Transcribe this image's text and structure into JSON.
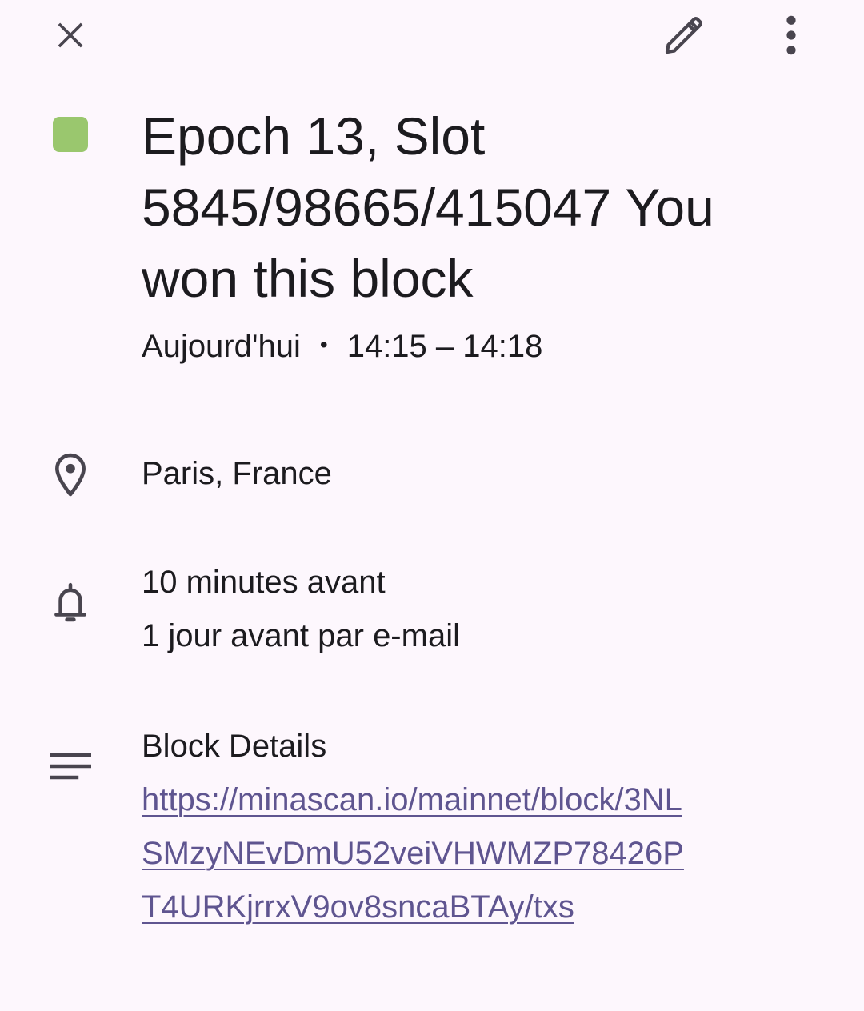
{
  "event": {
    "title": "Epoch 13, Slot 5845/98665/415047 You won this block",
    "color": "#9ac76e",
    "date": "Aujourd'hui",
    "separator": "•",
    "time_range": "14:15 – 14:18"
  },
  "location": {
    "text": "Paris, France"
  },
  "reminders": [
    {
      "text": "10 minutes avant"
    },
    {
      "text": "1 jour avant par e-mail"
    }
  ],
  "description": {
    "heading": "Block Details",
    "link": "https://minascan.io/mainnet/block/3NLSMzyNEvDmU52veiVHWMZP78426PT4URKjrrxV9ov8sncaBTAy/txs"
  },
  "colors": {
    "background": "#fdf7fd",
    "text": "#1c1b1f",
    "icon": "#49454f",
    "link": "#5f5590"
  }
}
